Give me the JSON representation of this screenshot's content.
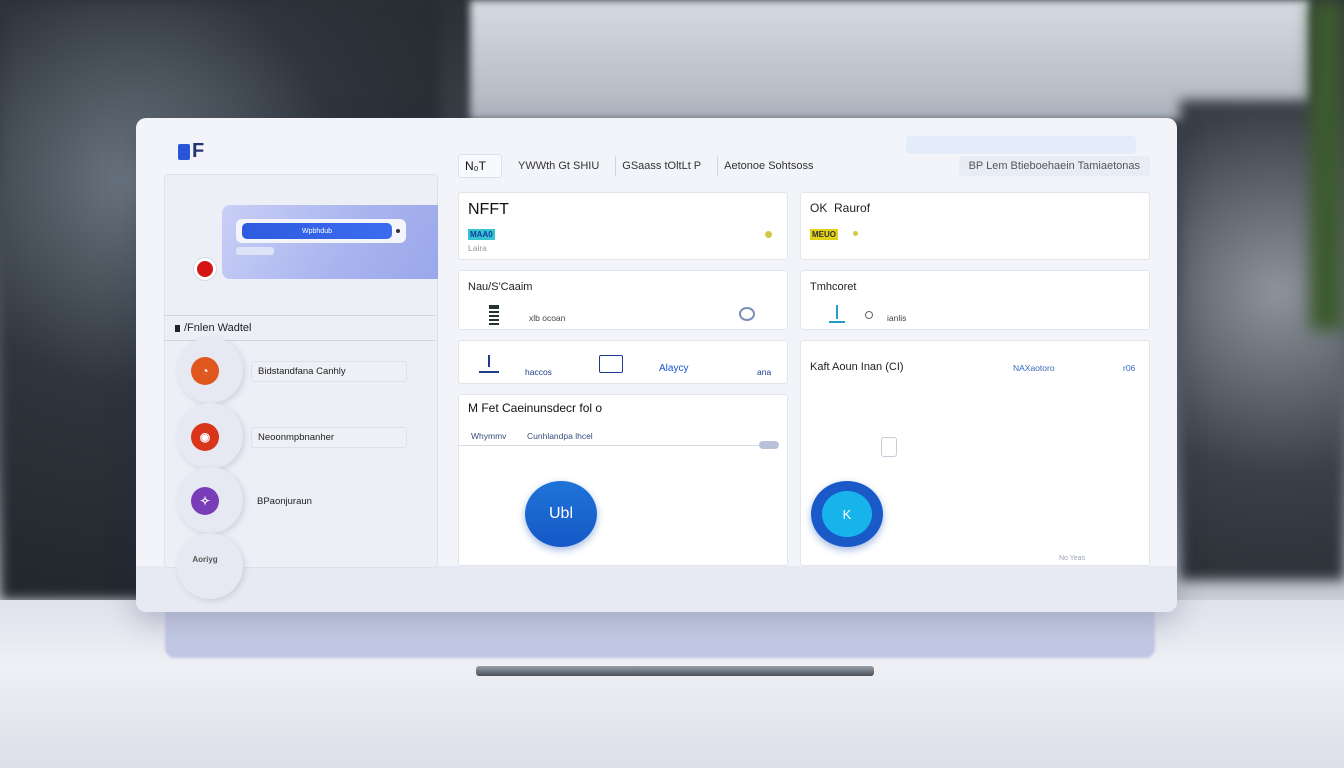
{
  "app": {
    "logo": "F"
  },
  "tabs": [
    {
      "label": "N₀T"
    },
    {
      "label": "YWWth Gt SHIU"
    },
    {
      "label": "GSaass tOltLt P"
    },
    {
      "label": "Aetonoe Sohtsoss"
    },
    {
      "label": "BP Lem Btieboehaein Tamiaetonas"
    }
  ],
  "sidebar": {
    "wallet_button_label": "Wpbhdub",
    "section_title": "/Fnlen Wadtel",
    "items": [
      {
        "label": "Bidstandfana Canhly",
        "color": "#e0561f"
      },
      {
        "label": "Neoonmpbnanher",
        "color": "#d9351a"
      },
      {
        "label": "BPaonjuraun",
        "color": "#7a3db8"
      },
      {
        "label": "Aoriyg",
        "color": "#8d97b3"
      }
    ]
  },
  "cards": {
    "nft": {
      "title": "NFFT",
      "tag": "MAA0",
      "sub": "Laira"
    },
    "raurof": {
      "title": "Raurof",
      "prefix": "OK",
      "tag": "MEUO"
    },
    "nausgaim": {
      "title": "Nau/S'Caaim",
      "sub": "xlb ocoan"
    },
    "timhcoret": {
      "title": "Tmhcoret",
      "sub": "ianlis"
    },
    "actions": {
      "a": "haccos",
      "b": "Alaycy",
      "c": "ana"
    },
    "kaft": {
      "title": "Kaft Aoun Inan (CI)",
      "link": "NAXaotoro",
      "num": "r06"
    },
    "mfet": {
      "title": "M Fet Caeinunsdecr fol o",
      "left": "Whymmv",
      "right": "Cunhlandpa lhcel",
      "button": "Ubl"
    },
    "circle": {
      "label": "K"
    }
  },
  "footer": {
    "note": "No  Yeas"
  },
  "colors": {
    "accent": "#1f66d6",
    "teal": "#16b4ea",
    "alert": "#d51515"
  }
}
